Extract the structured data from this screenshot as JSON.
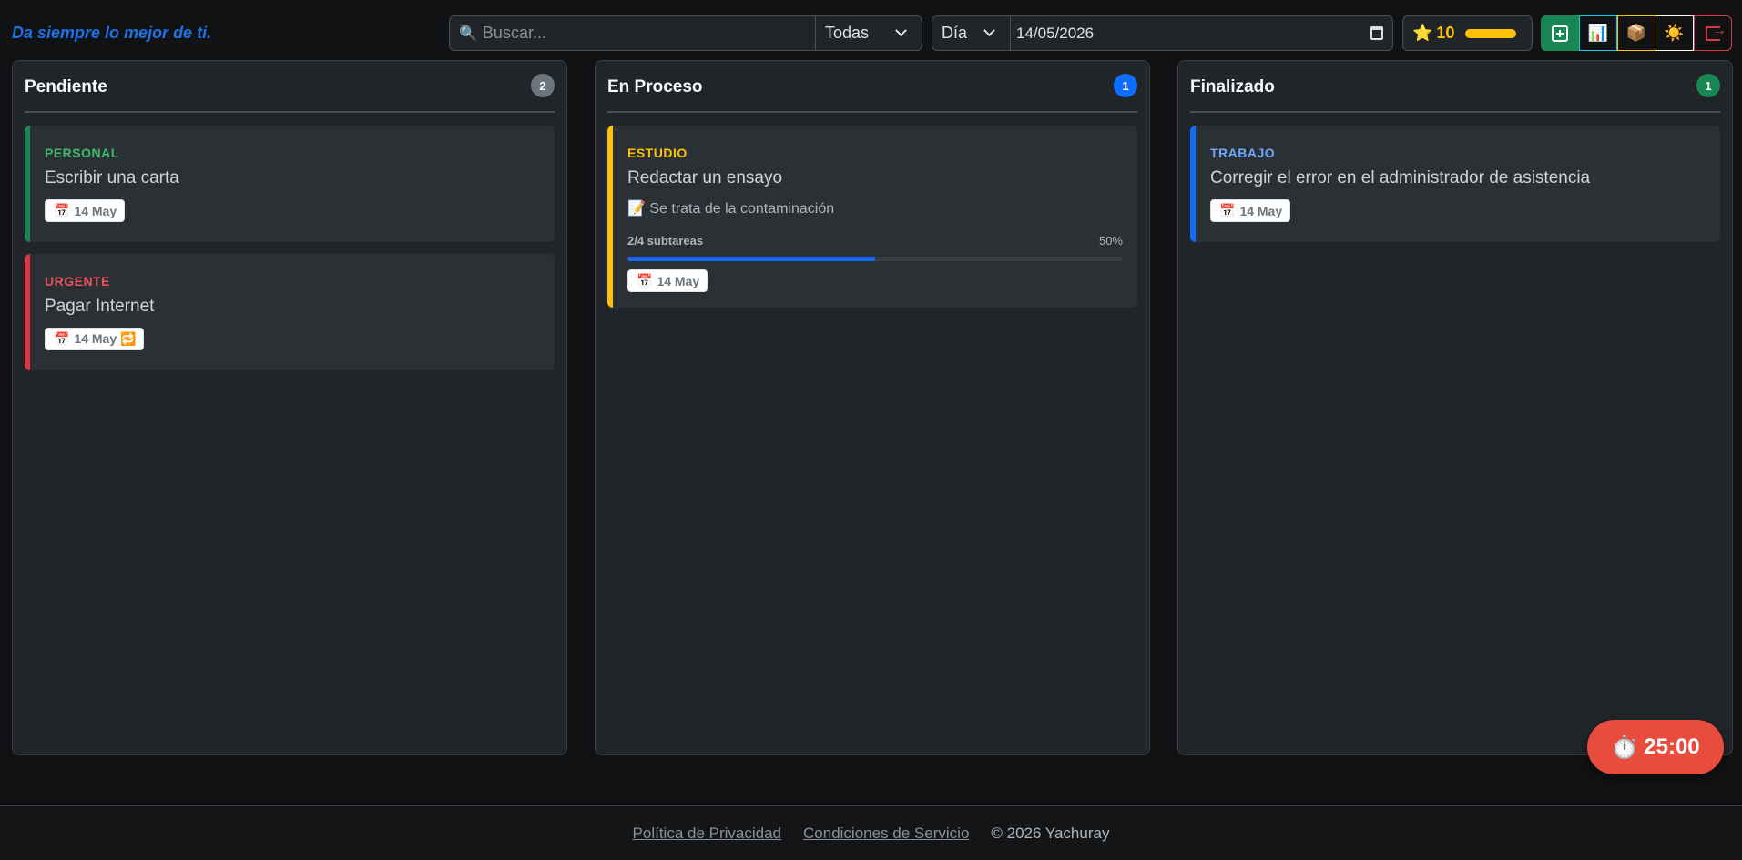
{
  "header": {
    "tagline": "Da siempre lo mejor de ti.",
    "search_placeholder": "Buscar...",
    "category_filter": "Todas",
    "view_mode": "Día",
    "date": "14/05/2026",
    "level": "10",
    "xp_progress": 1.0
  },
  "columns": [
    {
      "title": "Pendiente",
      "count": "2",
      "badge_color": "#6c757d",
      "cards": [
        {
          "category": "PERSONAL",
          "color": "#198754",
          "cat_color": "#3fb96b",
          "title": "Escribir una carta",
          "date": "14 May"
        },
        {
          "category": "URGENTE",
          "color": "#dc3545",
          "cat_color": "#e8535f",
          "title": "Pagar Internet",
          "date": "14 May 🔁"
        }
      ]
    },
    {
      "title": "En Proceso",
      "count": "1",
      "badge_color": "#0d6efd",
      "cards": [
        {
          "category": "ESTUDIO",
          "color": "#ffc107",
          "cat_color": "#ffc107",
          "title": "Redactar un ensayo",
          "description": "📝 Se trata de la contaminación",
          "subtasks": "2/4 subtareas",
          "percent": "50%",
          "progress": 0.5,
          "date": "14 May"
        }
      ]
    },
    {
      "title": "Finalizado",
      "count": "1",
      "badge_color": "#198754",
      "cards": [
        {
          "category": "TRABAJO",
          "color": "#0d6efd",
          "cat_color": "#6ea8fe",
          "title": "Corregir el error en el administrador de asistencia",
          "date": "14 May"
        }
      ]
    }
  ],
  "timer": {
    "icon": "⏱️",
    "time": "25:00"
  },
  "footer": {
    "privacy": "Política de Privacidad",
    "terms": "Condiciones de Servicio",
    "copyright": "© 2026 Yachuray"
  }
}
